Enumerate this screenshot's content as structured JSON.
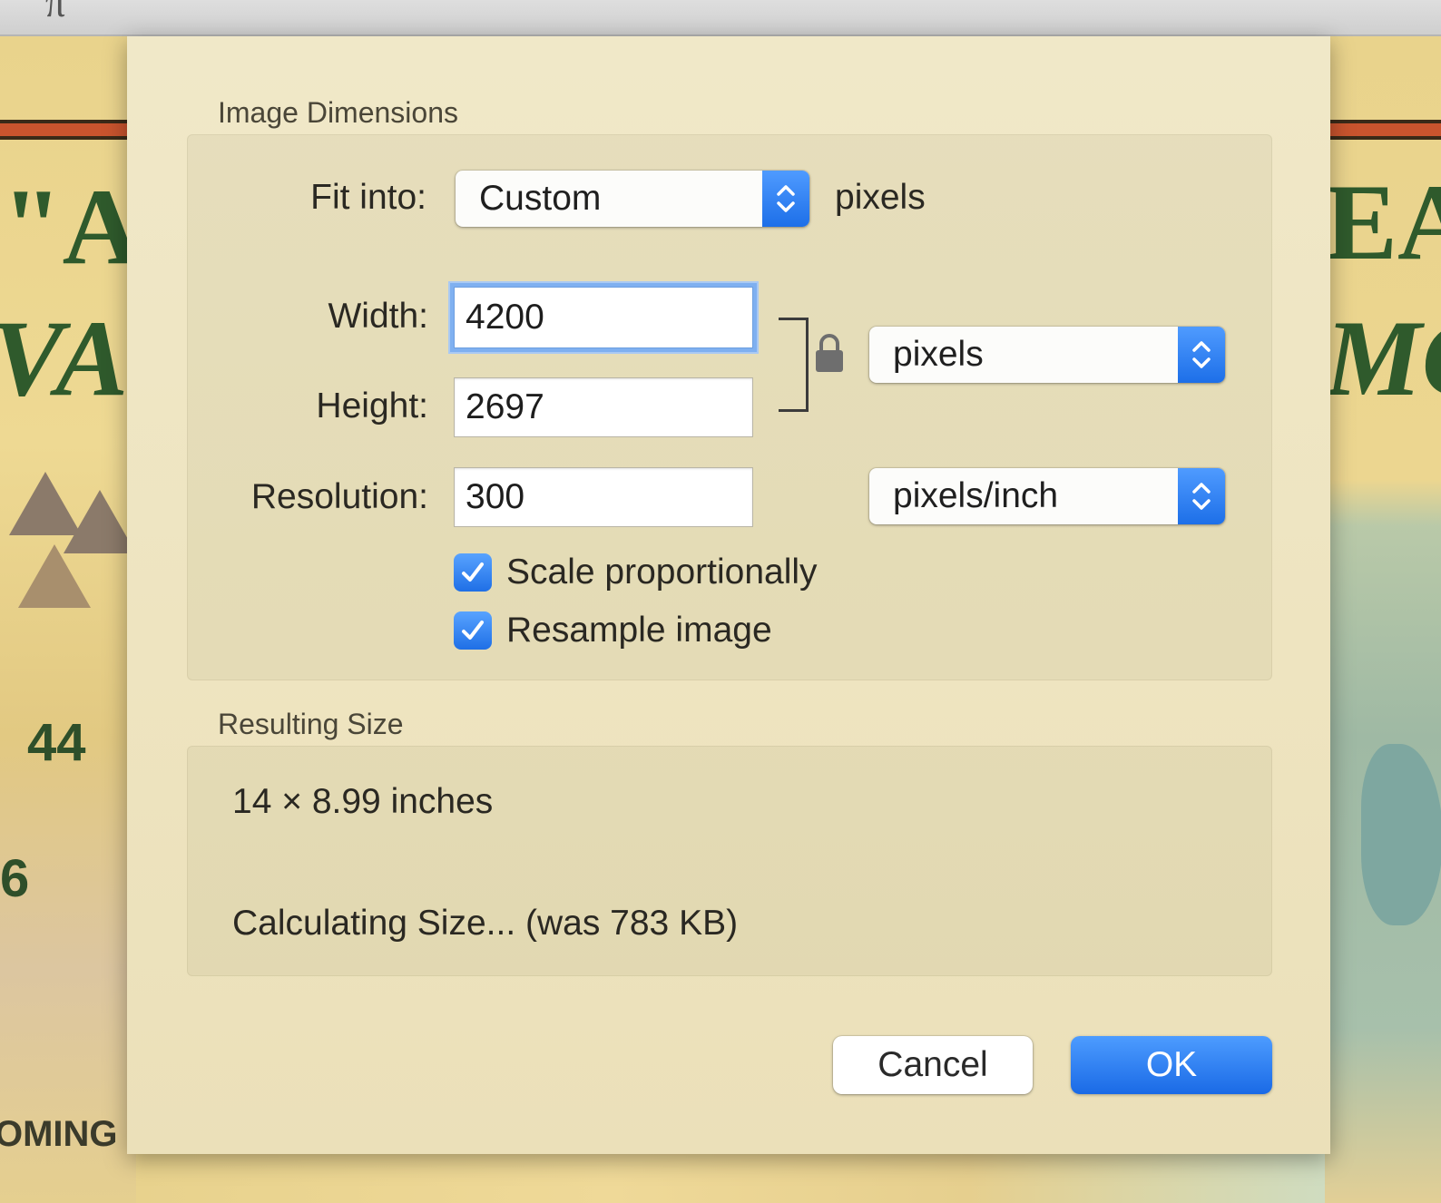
{
  "sheet": {
    "image_dimensions_title": "Image Dimensions",
    "fit_into": {
      "label": "Fit into:",
      "value": "Custom",
      "unit": "pixels"
    },
    "width": {
      "label": "Width:",
      "value": "4200"
    },
    "height": {
      "label": "Height:",
      "value": "2697"
    },
    "resolution": {
      "label": "Resolution:",
      "value": "300"
    },
    "size_unit_popup": "pixels",
    "resolution_unit_popup": "pixels/inch",
    "scale_proportionally": {
      "label": "Scale proportionally",
      "checked": true
    },
    "resample_image": {
      "label": "Resample image",
      "checked": true
    },
    "resulting_size_title": "Resulting Size",
    "resulting_dimensions": "14 × 8.99 inches",
    "resulting_file_size": "Calculating Size... (was 783 KB)",
    "cancel_label": "Cancel",
    "ok_label": "OK"
  },
  "background": {
    "map_text_left_1": "\"A",
    "map_text_left_2": "VA",
    "map_text_left_3": "44",
    "map_text_left_4": "6",
    "map_text_left_5": "OMING",
    "map_text_right_1": "EA",
    "map_text_right_2": "MC"
  },
  "colors": {
    "accent": "#1f6fe6",
    "sheet_background": "#eee4c0"
  }
}
